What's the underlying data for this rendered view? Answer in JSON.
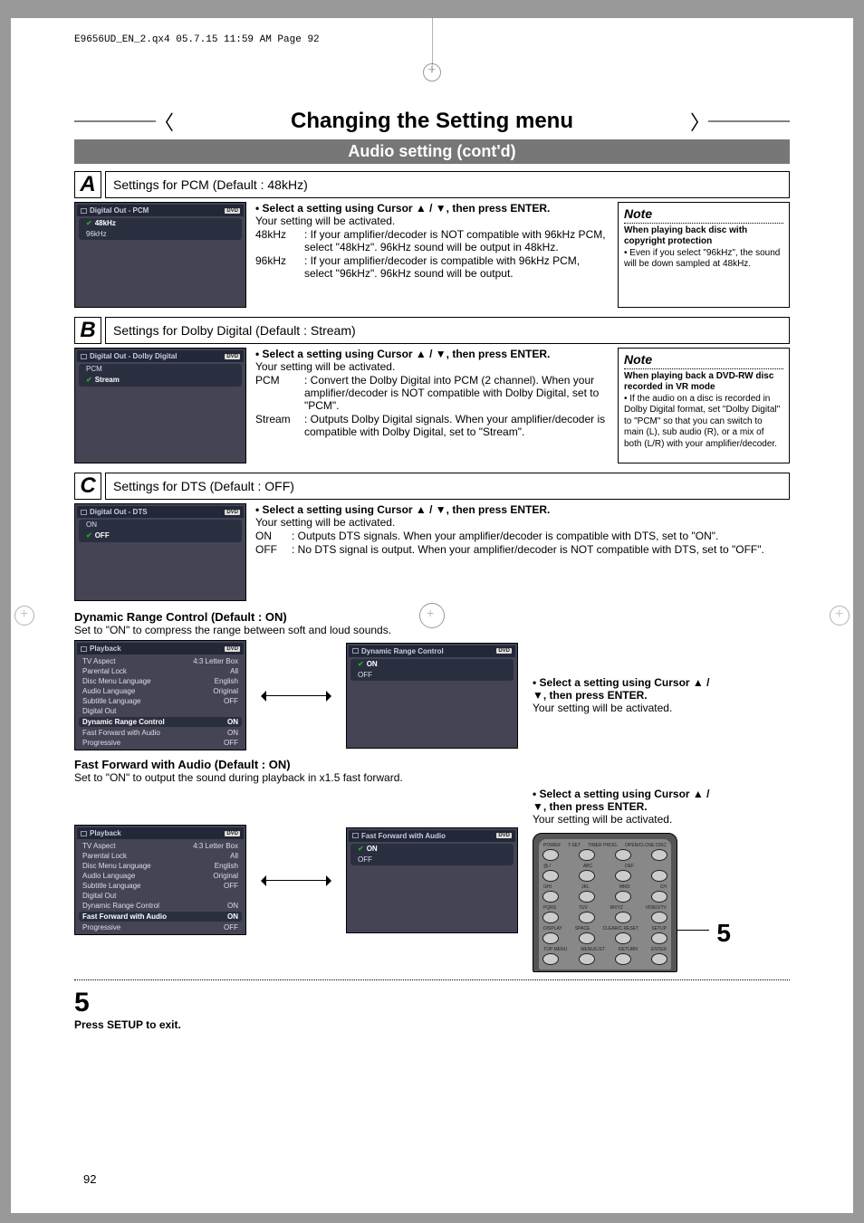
{
  "header_strip": "E9656UD_EN_2.qx4  05.7.15  11:59 AM  Page 92",
  "title": "Changing the Setting menu",
  "subtitle": "Audio setting (cont'd)",
  "page_number": "92",
  "sectA": {
    "letter": "A",
    "title": "Settings for PCM (Default : 48kHz)",
    "ui": {
      "header": "Digital Out - PCM",
      "badge": "DVD",
      "rows": [
        {
          "label": "48kHz",
          "selected": true
        },
        {
          "label": "96kHz",
          "selected": false
        }
      ]
    },
    "bullet": "• Select a setting using Cursor ▲ / ▼, then press ENTER.",
    "line1": "Your setting will be activated.",
    "opt1_lbl": "48kHz",
    "opt1_txt": ": If your amplifier/decoder is NOT compatible with 96kHz PCM, select \"48kHz\". 96kHz sound will be output in 48kHz.",
    "opt2_lbl": "96kHz",
    "opt2_txt": ": If your amplifier/decoder is compatible with 96kHz PCM, select \"96kHz\". 96kHz sound will be output.",
    "note": {
      "title": "Note",
      "bold": "When playing back disc with copyright protection",
      "body": "• Even if you select \"96kHz\", the sound will be down sampled at 48kHz."
    }
  },
  "sectB": {
    "letter": "B",
    "title": "Settings for Dolby Digital (Default : Stream)",
    "ui": {
      "header": "Digital Out - Dolby Digital",
      "badge": "DVD",
      "rows": [
        {
          "label": "PCM",
          "selected": false
        },
        {
          "label": "Stream",
          "selected": true
        }
      ]
    },
    "bullet": "• Select a setting using Cursor ▲ / ▼, then press ENTER.",
    "line1": "Your setting will be activated.",
    "opt1_lbl": "PCM",
    "opt1_txt": ": Convert the Dolby Digital into PCM (2 channel). When your amplifier/decoder is NOT compatible with Dolby Digital, set to \"PCM\".",
    "opt2_lbl": "Stream",
    "opt2_txt": ": Outputs Dolby Digital signals. When your amplifier/decoder is compatible with Dolby Digital, set to \"Stream\".",
    "note": {
      "title": "Note",
      "bold": "When playing back a DVD-RW disc recorded in VR mode",
      "body": "• If the audio on a disc is recorded in Dolby Digital format, set \"Dolby Digital\" to \"PCM\" so that you can switch to main (L), sub audio (R), or a mix of both (L/R) with your amplifier/decoder."
    }
  },
  "sectC": {
    "letter": "C",
    "title": "Settings for DTS (Default : OFF)",
    "ui": {
      "header": "Digital Out - DTS",
      "badge": "DVD",
      "rows": [
        {
          "label": "ON",
          "selected": false
        },
        {
          "label": "OFF",
          "selected": true
        }
      ]
    },
    "bullet": "• Select a setting using Cursor ▲ / ▼, then press ENTER.",
    "line1": "Your setting will be activated.",
    "opt1_lbl": "ON",
    "opt1_txt": ": Outputs DTS signals. When your amplifier/decoder is compatible with DTS, set to \"ON\".",
    "opt2_lbl": "OFF",
    "opt2_txt": ": No DTS signal is output. When your amplifier/decoder is NOT compatible with DTS, set to \"OFF\"."
  },
  "drc": {
    "heading": "Dynamic Range Control (Default : ON)",
    "sub": "Set to \"ON\" to compress the range between soft and loud sounds.",
    "ui_left": {
      "header": "Playback",
      "badge": "DVD",
      "rows": [
        [
          "TV Aspect",
          "4:3 Letter Box"
        ],
        [
          "Parental Lock",
          "All"
        ],
        [
          "Disc Menu Language",
          "English"
        ],
        [
          "Audio Language",
          "Original"
        ],
        [
          "Subtitle Language",
          "OFF"
        ],
        [
          "Digital Out",
          ""
        ],
        [
          "Dynamic Range Control",
          "ON"
        ],
        [
          "Fast Forward with Audio",
          "ON"
        ],
        [
          "Progressive",
          "OFF"
        ]
      ],
      "selected_idx": 6
    },
    "ui_right": {
      "header": "Dynamic Range Control",
      "badge": "DVD",
      "rows": [
        {
          "label": "ON",
          "selected": true
        },
        {
          "label": "OFF",
          "selected": false
        }
      ]
    },
    "instr_b": "• Select a setting using Cursor ▲ / ▼, then press ENTER.",
    "instr": "Your setting will be activated."
  },
  "ffa": {
    "heading": "Fast Forward with Audio (Default : ON)",
    "sub": "Set to \"ON\" to output the sound during playback in x1.5 fast forward.",
    "ui_left": {
      "header": "Playback",
      "badge": "DVD",
      "rows": [
        [
          "TV Aspect",
          "4:3 Letter Box"
        ],
        [
          "Parental Lock",
          "All"
        ],
        [
          "Disc Menu Language",
          "English"
        ],
        [
          "Audio Language",
          "Original"
        ],
        [
          "Subtitle Language",
          "OFF"
        ],
        [
          "Digital Out",
          ""
        ],
        [
          "Dynamic Range Control",
          "ON"
        ],
        [
          "Fast Forward with Audio",
          "ON"
        ],
        [
          "Progressive",
          "OFF"
        ]
      ],
      "selected_idx": 7
    },
    "ui_right": {
      "header": "Fast Forward with Audio",
      "badge": "DVD",
      "rows": [
        {
          "label": "ON",
          "selected": true
        },
        {
          "label": "OFF",
          "selected": false
        }
      ]
    },
    "instr_b": "• Select a setting using Cursor ▲ / ▼, then press ENTER.",
    "instr": "Your setting will be activated."
  },
  "step5": {
    "num": "5",
    "text": "Press SETUP to exit."
  },
  "remote": {
    "row_labels": [
      [
        "POWER",
        "T-SET",
        "TIMER PROG.",
        "OPEN/CLOSE DISC"
      ],
      [
        "@./",
        "ABC",
        "DEF",
        ""
      ],
      [
        "GHI",
        "JKL",
        "MNO",
        "CH"
      ],
      [
        "PQRS",
        "TUV",
        "WXYZ",
        "VIDEO/TV"
      ],
      [
        "DISPLAY",
        "SPACE",
        "CLEAR/C.RESET",
        "SETUP"
      ],
      [
        "TOP MENU",
        "MENU/LIST",
        "RETURN",
        "ENTER"
      ]
    ],
    "highlight": "5"
  }
}
